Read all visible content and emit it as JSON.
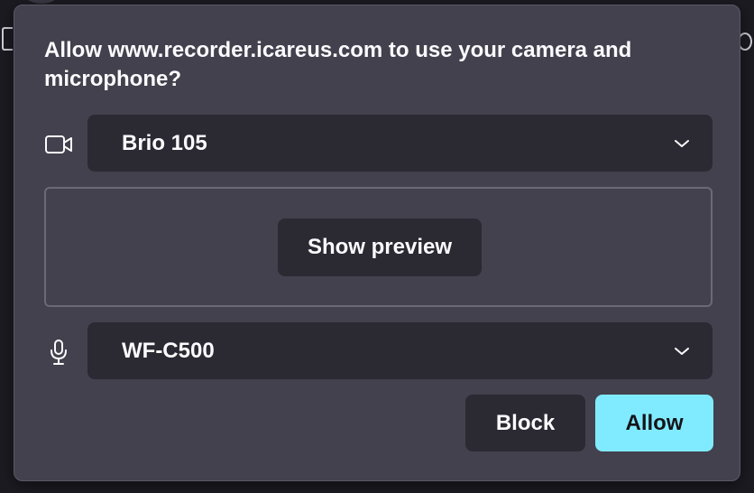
{
  "dialog": {
    "title": "Allow www.recorder.icareus.com to use your camera and microphone?",
    "camera": {
      "icon": "camera-icon",
      "selected": "Brio 105"
    },
    "preview": {
      "button_label": "Show preview"
    },
    "microphone": {
      "icon": "microphone-icon",
      "selected": "WF-C500"
    },
    "actions": {
      "block_label": "Block",
      "allow_label": "Allow"
    }
  },
  "colors": {
    "panel_bg": "#42414d",
    "control_bg": "#2b2a33",
    "accent": "#80ebff",
    "text": "#fbfbfe"
  }
}
